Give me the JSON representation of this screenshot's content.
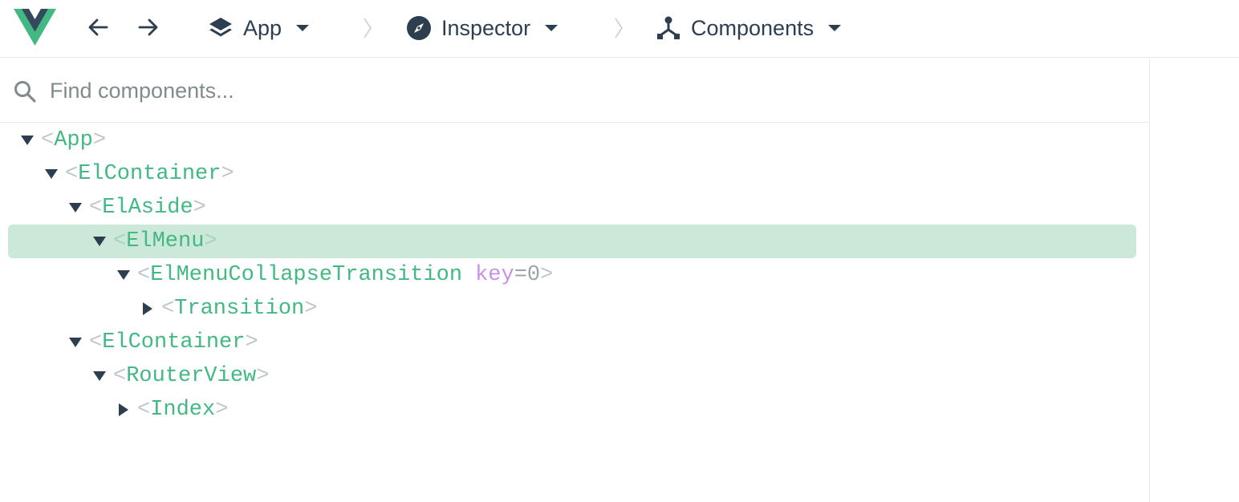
{
  "app": {
    "logo": "vue-logo",
    "colors": {
      "accent": "#42b983",
      "dark": "#35495e",
      "text": "#2c3e50",
      "selected_bg": "#cbe8d9",
      "attr_key": "#c792ea"
    }
  },
  "toolbar": {
    "back_icon": "arrow-left-icon",
    "forward_icon": "arrow-right-icon",
    "breadcrumb": [
      {
        "label": "App",
        "icon": "layers-icon"
      },
      {
        "label": "Inspector",
        "icon": "compass-icon"
      },
      {
        "label": "Components",
        "icon": "component-tree-icon"
      }
    ]
  },
  "search": {
    "placeholder": "Find components...",
    "value": ""
  },
  "tree": {
    "open_bracket": "<",
    "close_bracket": ">",
    "nodes": [
      {
        "name": "App",
        "expanded": true,
        "selected": false
      },
      {
        "name": "ElContainer",
        "expanded": true,
        "selected": false
      },
      {
        "name": "ElAside",
        "expanded": true,
        "selected": false
      },
      {
        "name": "ElMenu",
        "expanded": true,
        "selected": true
      },
      {
        "name": "ElMenuCollapseTransition",
        "expanded": true,
        "selected": false,
        "attr_key": "key",
        "attr_eq": "=",
        "attr_value": "0"
      },
      {
        "name": "Transition",
        "expanded": false,
        "selected": false
      },
      {
        "name": "ElContainer",
        "expanded": true,
        "selected": false
      },
      {
        "name": "RouterView",
        "expanded": true,
        "selected": false
      },
      {
        "name": "Index",
        "expanded": false,
        "selected": false
      }
    ]
  }
}
